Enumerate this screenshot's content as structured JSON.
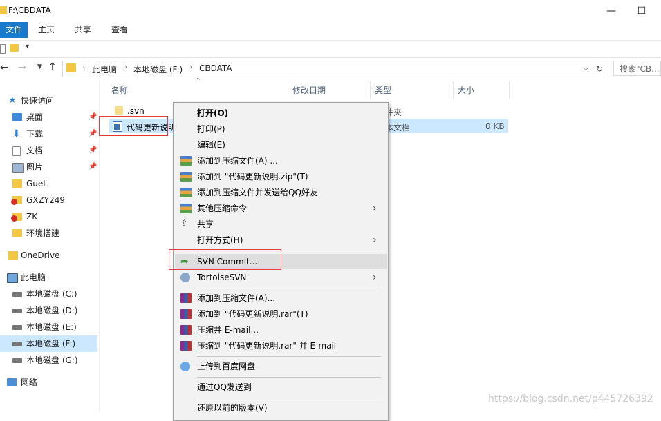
{
  "window": {
    "title": "F:\\CBDATA"
  },
  "ribbon": {
    "tabs": [
      "文件",
      "主页",
      "共享",
      "查看"
    ]
  },
  "address": {
    "crumbs": [
      "此电脑",
      "本地磁盘 (F:)",
      "CBDATA"
    ],
    "search_placeholder": "搜索\"CB..."
  },
  "nav": {
    "quick_access": "快速访问",
    "pinned": [
      "桌面",
      "下载",
      "文档",
      "图片"
    ],
    "folders": [
      "Guet",
      "GXZY249",
      "ZK",
      "环境搭建"
    ],
    "onedrive": "OneDrive",
    "this_pc": "此电脑",
    "drives": [
      "本地磁盘 (C:)",
      "本地磁盘 (D:)",
      "本地磁盘 (E:)",
      "本地磁盘 (F:)",
      "本地磁盘 (G:)"
    ],
    "network": "网络"
  },
  "columns": {
    "name": "名称",
    "modified": "修改日期",
    "type": "类型",
    "size": "大小"
  },
  "files": [
    {
      "name": ".svn",
      "type": "件夹",
      "size": ""
    },
    {
      "name": "代码更新说明",
      "type": "本文档",
      "size": "0 KB"
    }
  ],
  "menu": {
    "open": "打开(O)",
    "print": "打印(P)",
    "edit": "编辑(E)",
    "add_archive_a": "添加到压缩文件(A) ...",
    "add_zip": "添加到 \"代码更新说明.zip\"(T)",
    "add_send_qq": "添加到压缩文件并发送给QQ好友",
    "other_compress": "其他压缩命令",
    "share": "共享",
    "open_with": "打开方式(H)",
    "svn_commit": "SVN Commit...",
    "tortoise": "TortoiseSVN",
    "rar_add": "添加到压缩文件(A)...",
    "rar_add_named": "添加到 \"代码更新说明.rar\"(T)",
    "rar_email": "压缩并 E-mail...",
    "rar_email_named": "压缩到 \"代码更新说明.rar\" 并 E-mail",
    "baidu": "上传到百度网盘",
    "qq_send": "通过QQ发送到",
    "restore": "还原以前的版本(V)"
  },
  "watermark": "https://blog.csdn.net/p445726392"
}
